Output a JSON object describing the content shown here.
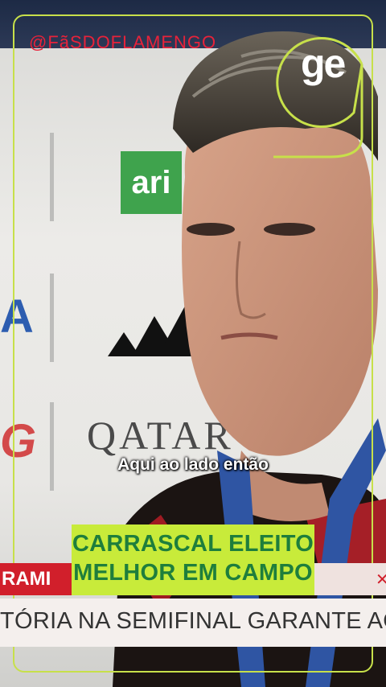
{
  "overlay": {
    "handle": "@FãSDOFLAMENGO",
    "brand_logo": "ge",
    "subtitle": "Aqui ao lado então",
    "headline_line1": "CARRASCAL ELEITO",
    "headline_line2": "MELHOR EM CAMPO",
    "tag_label": "RAMI",
    "ticker_text": "TÓRIA NA SEMIFINAL GARANTE AO FLAME"
  },
  "backdrop": {
    "sponsor_green": "ari",
    "sponsor_qatar": "QATAR",
    "left_logo_a": "A",
    "left_logo_red": "G"
  },
  "colors": {
    "accent_lime": "#c8eb3a",
    "headline_text": "#1e7e3c",
    "handle_red": "#e8223a",
    "tag_red": "#d11f2b"
  }
}
